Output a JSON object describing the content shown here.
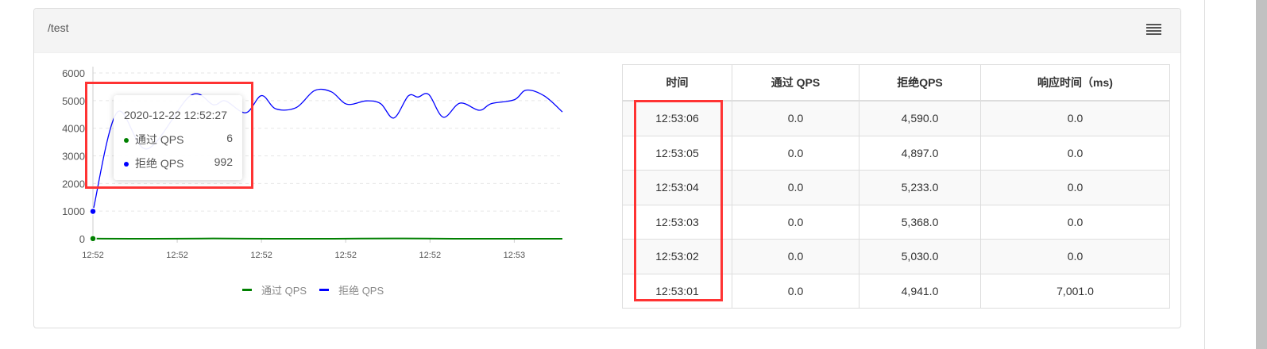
{
  "panel": {
    "title": "/test"
  },
  "chart_data": {
    "type": "line",
    "ylim": [
      0,
      6000
    ],
    "yticks": [
      "0",
      "1000",
      "2000",
      "3000",
      "4000",
      "5000",
      "6000"
    ],
    "ytick_values": [
      0,
      1000,
      2000,
      3000,
      4000,
      5000,
      6000
    ],
    "xtick_seconds": [
      0,
      7,
      14,
      21,
      28,
      35
    ],
    "xtick_labels": [
      "12:52",
      "12:52",
      "12:52",
      "12:52",
      "12:52",
      "12:53"
    ],
    "x_range_seconds": [
      0,
      39
    ],
    "grid": true,
    "legend_position": "bottom",
    "series": [
      {
        "name": "通过 QPS",
        "color": "#008000",
        "x": [
          0,
          5,
          10,
          15,
          20,
          25,
          30,
          35,
          39
        ],
        "y": [
          6,
          0,
          10,
          0,
          0,
          12,
          0,
          0,
          0
        ]
      },
      {
        "name": "拒绝 QPS",
        "color": "#0000ff",
        "x": [
          0,
          2,
          4.5,
          8.1,
          10,
          11,
          12.7,
          14,
          15.2,
          16.9,
          18.4,
          19.8,
          21.1,
          22.7,
          23.9,
          25,
          26.2,
          27,
          27.9,
          29.1,
          30.5,
          32.1,
          33.1,
          35,
          36,
          37.5,
          39
        ],
        "y": [
          992,
          4570,
          3250,
          5180,
          4850,
          4990,
          4560,
          5180,
          4700,
          4750,
          5360,
          5320,
          4870,
          4990,
          4890,
          4370,
          5170,
          5130,
          5220,
          4400,
          4910,
          4650,
          4890,
          5030,
          5380,
          5170,
          4590
        ]
      }
    ]
  },
  "tooltip": {
    "title": "2020-12-22 12:52:27",
    "rows": [
      {
        "label": "通过 QPS",
        "value": "6",
        "color": "#008000"
      },
      {
        "label": "拒绝 QPS",
        "value": "992",
        "color": "#0000ff"
      }
    ]
  },
  "legend": [
    {
      "label": "通过 QPS",
      "color": "#008000"
    },
    {
      "label": "拒绝 QPS",
      "color": "#0000ff"
    }
  ],
  "table": {
    "headers": [
      "时间",
      "通过 QPS",
      "拒绝QPS",
      "响应时间（ms)"
    ],
    "rows": [
      [
        "12:53:06",
        "0.0",
        "4,590.0",
        "0.0"
      ],
      [
        "12:53:05",
        "0.0",
        "4,897.0",
        "0.0"
      ],
      [
        "12:53:04",
        "0.0",
        "5,233.0",
        "0.0"
      ],
      [
        "12:53:03",
        "0.0",
        "5,368.0",
        "0.0"
      ],
      [
        "12:53:02",
        "0.0",
        "5,030.0",
        "0.0"
      ],
      [
        "12:53:01",
        "0.0",
        "4,941.0",
        "7,001.0"
      ]
    ]
  }
}
